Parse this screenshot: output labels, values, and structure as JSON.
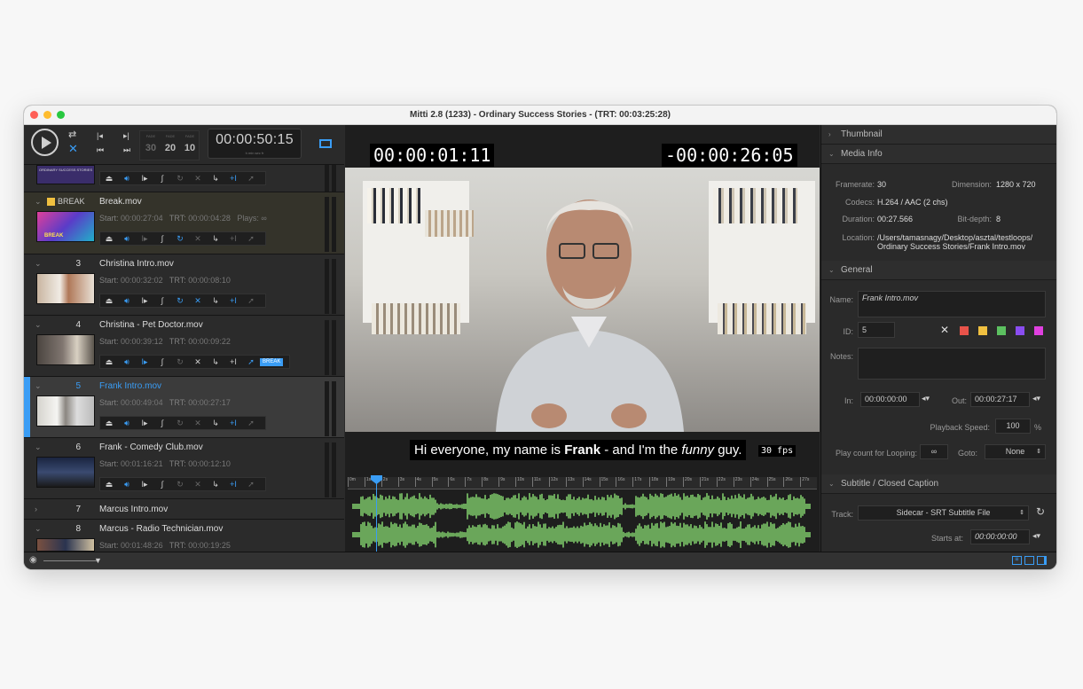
{
  "window": {
    "title": "Mitti 2.8 (1233) - Ordinary Success Stories - (TRT: 00:03:25:28)"
  },
  "toolbar": {
    "fades": [
      {
        "label": "FADE",
        "value": "30"
      },
      {
        "label": "FADE",
        "value": "20"
      },
      {
        "label": "FADE",
        "value": "10"
      }
    ],
    "clock": "00:00:50:15",
    "clock_units": "h          min          sec          fr"
  },
  "cues": [
    {
      "num": "",
      "name": "",
      "thumb_text": "ORDINARY SUCCESS STORIES"
    },
    {
      "num": "BREAK",
      "name": "Break.mov",
      "start": "00:00:27:04",
      "trt": "00:00:04:28",
      "plays": "Plays: ∞",
      "thumb_text": "BREAK"
    },
    {
      "num": "3",
      "name": "Christina Intro.mov",
      "start": "00:00:32:02",
      "trt": "00:00:08:10"
    },
    {
      "num": "4",
      "name": "Christina - Pet Doctor.mov",
      "start": "00:00:39:12",
      "trt": "00:00:09:22",
      "badge": "BREAK"
    },
    {
      "num": "5",
      "name": "Frank Intro.mov",
      "start": "00:00:49:04",
      "trt": "00:00:27:17"
    },
    {
      "num": "6",
      "name": "Frank - Comedy Club.mov",
      "start": "00:01:16:21",
      "trt": "00:00:12:10"
    },
    {
      "num": "7",
      "name": "Marcus Intro.mov"
    },
    {
      "num": "8",
      "name": "Marcus - Radio Technician.mov",
      "start": "00:01:48:26",
      "trt": "00:00:19:25"
    }
  ],
  "labels": {
    "start": "Start:",
    "trt": "TRT:"
  },
  "player": {
    "elapsed": "00:00:01:11",
    "remaining": "-00:00:26:05",
    "subtitle_pre": "Hi everyone, my name is ",
    "subtitle_bold": "Frank",
    "subtitle_mid": " - and I'm the ",
    "subtitle_it": "funny",
    "subtitle_post": " guy.",
    "fps": "30 fps",
    "ruler": [
      "0m",
      "1s",
      "2s",
      "3s",
      "4s",
      "5s",
      "6s",
      "7s",
      "8s",
      "9s",
      "10s",
      "11s",
      "12s",
      "13s",
      "14s",
      "15s",
      "16s",
      "17s",
      "18s",
      "19s",
      "20s",
      "21s",
      "22s",
      "23s",
      "24s",
      "25s",
      "26s",
      "27s"
    ]
  },
  "inspector": {
    "thumbnail": "Thumbnail",
    "media_info": "Media Info",
    "framerate_label": "Framerate:",
    "framerate": "30",
    "dimension_label": "Dimension:",
    "dimension": "1280 x 720",
    "codecs_label": "Codecs:",
    "codecs": "H.264 / AAC (2 chs)",
    "duration_label": "Duration:",
    "duration": "00:27.566",
    "bitdepth_label": "Bit-depth:",
    "bitdepth": "8",
    "location_label": "Location:",
    "location1": "/Users/tamasnagy/Desktop/asztal/testloops/",
    "location2": "Ordinary Success Stories/Frank Intro.mov",
    "general": "General",
    "name_label": "Name:",
    "name": "Frank Intro.mov",
    "id_label": "ID:",
    "id": "5",
    "notes_label": "Notes:",
    "in_label": "In:",
    "in": "00:00:00:00",
    "out_label": "Out:",
    "out": "00:00:27:17",
    "speed_label": "Playback  Speed:",
    "speed": "100",
    "speed_unit": "%",
    "playcount_label": "Play count for Looping:",
    "playcount": "∞",
    "goto_label": "Goto:",
    "goto": "None",
    "subtitle_section": "Subtitle / Closed Caption",
    "track_label": "Track:",
    "track": "Sidecar - SRT Subtitle File",
    "startsat_label": "Starts at:",
    "startsat": "00:00:00:00",
    "colors": [
      "#e8534a",
      "#f0c040",
      "#5cc060",
      "#8a4df0",
      "#e040e0"
    ]
  }
}
